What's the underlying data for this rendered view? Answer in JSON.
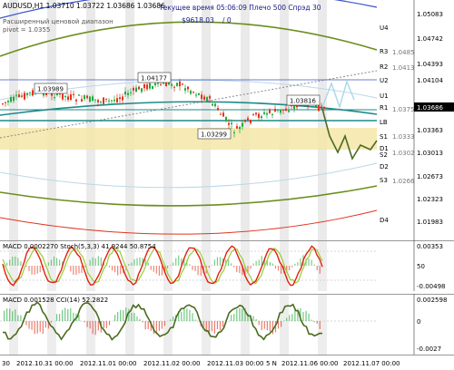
{
  "chart": {
    "header": "AUDUSD,H1  1.03710 1.03722 1.03686 1.03686",
    "overlay_title": "Текущее время 05:06:09 Плечо 500 Спрэд 30",
    "balance": "$9618.03",
    "balance_sep": "/ 0",
    "range_label": "Расширенный ценовой диапазон",
    "pivot_label": "pivot = 1.0355"
  },
  "price_axis": {
    "labels": [
      "1.05083",
      "1.04742",
      "1.04393",
      "1.04104",
      "1.03686",
      "1.03363",
      "1.03013",
      "1.02673",
      "1.02323",
      "1.01983"
    ],
    "current_price": "1.03686"
  },
  "levels": {
    "right": [
      "U4",
      "R3",
      "R2",
      "U2",
      "U1",
      "R1",
      "LB",
      "S1",
      "D1",
      "S2",
      "D2",
      "S3",
      "D4"
    ],
    "left": [
      "R3",
      "S1",
      "S2"
    ],
    "mid": [
      "1.0485",
      "1.0413",
      "1.0375",
      "1.0333",
      "1.0302",
      "1.0266"
    ]
  },
  "price_annotations": {
    "high_left": "1.03989",
    "high_mid": "1.04177",
    "low_mid": "1.03299",
    "high_right": "1.03816"
  },
  "oscillator": {
    "label": "MACD 0.0002270  Stoch(5,3,3) 41.9244 50.8754",
    "axis": [
      "0.00353",
      "50",
      "-0.00498"
    ]
  },
  "cci": {
    "label": "MACD 0.001528  CCI(14) 52.2822",
    "axis": [
      "0.002598",
      "0",
      "-0.0027"
    ]
  },
  "time_axis": {
    "labels": [
      "30",
      "2012.10.31 00:00",
      "2012.11.01 00:00",
      "2012.11.02 00:00",
      "2012.11.03 00:00",
      "5 N",
      "2012.11.06 00:00",
      "2012.11.07 00:00"
    ]
  },
  "colors": {
    "bull_candle": "#1faa3c",
    "bear_candle": "#e0341e",
    "stoch_main": "#e02010",
    "stoch_signal": "#9acd32",
    "cci_line": "#4b6b1e",
    "zone_yellow": "#f5e6a8",
    "session_bar": "#d8d8d8"
  }
}
